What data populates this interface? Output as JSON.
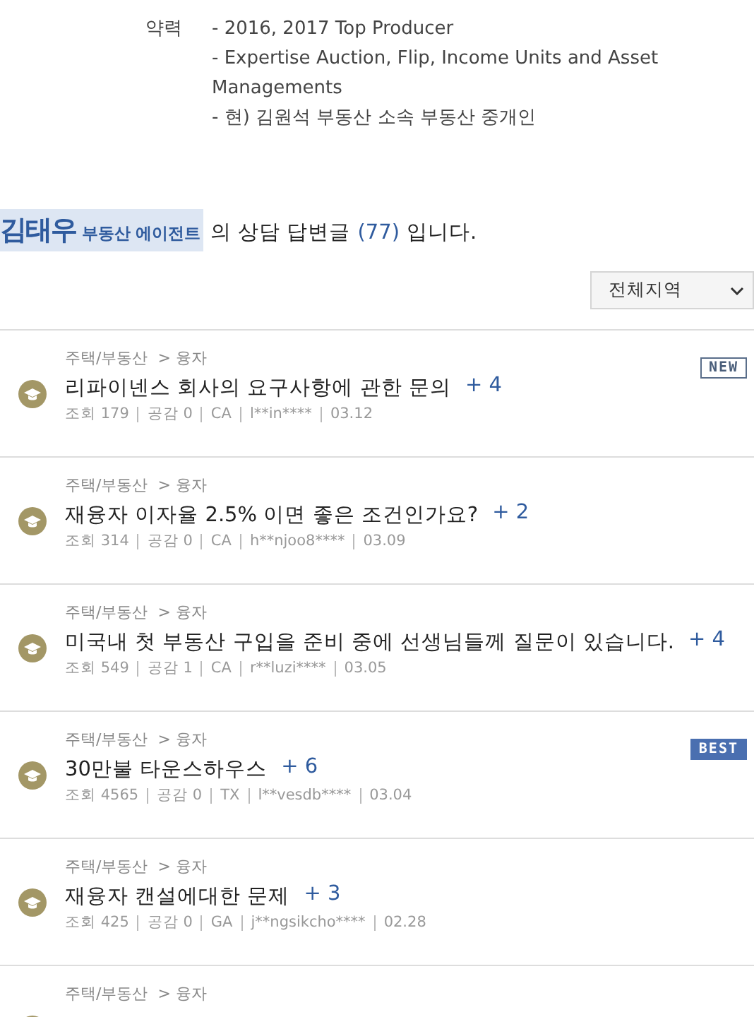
{
  "profile": {
    "label": "약력",
    "lines": [
      "- 2016, 2017 Top Producer",
      "- Expertise Auction, Flip, Income Units and Asset Managements",
      "- 현) 김원석 부동산 소속 부동산 중개인"
    ]
  },
  "heading": {
    "name": "김태우",
    "role": "부동산 에이전트",
    "text_before": "의 상담 답변글",
    "count": "(77)",
    "text_after": "입니다."
  },
  "region_select": {
    "value": "전체지역"
  },
  "posts": [
    {
      "category": "주택/부동산  > 융자",
      "title": "리파이넨스 회사의 요구사항에 관한 문의",
      "answers": "+ 4",
      "meta": [
        "조회 179",
        "공감 0",
        "CA",
        "l**in****",
        "03.12"
      ],
      "badge": {
        "kind": "new",
        "label": "NEW"
      }
    },
    {
      "category": "주택/부동산  > 융자",
      "title": "재융자 이자율 2.5% 이면 좋은 조건인가요?",
      "answers": "+ 2",
      "meta": [
        "조회 314",
        "공감 0",
        "CA",
        "h**njoo8****",
        "03.09"
      ]
    },
    {
      "category": "주택/부동산  > 융자",
      "title": "미국내 첫 부동산 구입을 준비 중에 선생님들께 질문이 있습니다.",
      "answers": "+ 4",
      "meta": [
        "조회 549",
        "공감 1",
        "CA",
        "r**luzi****",
        "03.05"
      ]
    },
    {
      "category": "주택/부동산  > 융자",
      "title": "30만불 타운스하우스",
      "answers": "+ 6",
      "meta": [
        "조회 4565",
        "공감 0",
        "TX",
        "l**vesdb****",
        "03.04"
      ],
      "badge": {
        "kind": "best",
        "label": "BEST"
      }
    },
    {
      "category": "주택/부동산  > 융자",
      "title": "재융자 캔설에대한 문제",
      "answers": "+ 3",
      "meta": [
        "조회 425",
        "공감 0",
        "GA",
        "j**ngsikcho****",
        "02.28"
      ]
    },
    {
      "category": "주택/부동산  > 융자"
    }
  ]
}
